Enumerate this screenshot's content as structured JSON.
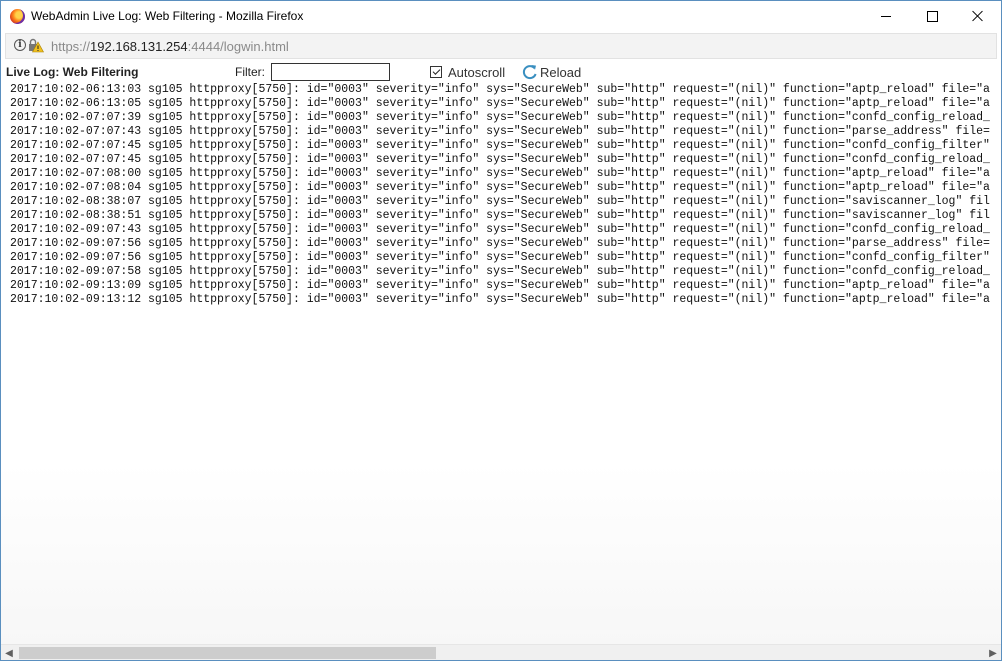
{
  "window": {
    "title": "WebAdmin Live Log: Web Filtering - Mozilla Firefox"
  },
  "urlbar": {
    "scheme": "https://",
    "host": "192.168.131.254",
    "rest": ":4444/logwin.html"
  },
  "app": {
    "title": "Live Log: Web Filtering",
    "filter_label": "Filter:",
    "filter_value": "",
    "autoscroll_label": "Autoscroll",
    "autoscroll_checked": true,
    "reload_label": "Reload"
  },
  "icons": {
    "browser": "firefox-icon",
    "info": "info-icon",
    "security": "mixed-content-lock-icon",
    "reload": "reload-icon"
  },
  "log": {
    "lines": [
      "2017:10:02-06:13:03 sg105 httpproxy[5750]: id=\"0003\" severity=\"info\" sys=\"SecureWeb\" sub=\"http\" request=\"(nil)\" function=\"aptp_reload\" file=\"a",
      "2017:10:02-06:13:05 sg105 httpproxy[5750]: id=\"0003\" severity=\"info\" sys=\"SecureWeb\" sub=\"http\" request=\"(nil)\" function=\"aptp_reload\" file=\"a",
      "2017:10:02-07:07:39 sg105 httpproxy[5750]: id=\"0003\" severity=\"info\" sys=\"SecureWeb\" sub=\"http\" request=\"(nil)\" function=\"confd_config_reload_",
      "2017:10:02-07:07:43 sg105 httpproxy[5750]: id=\"0003\" severity=\"info\" sys=\"SecureWeb\" sub=\"http\" request=\"(nil)\" function=\"parse_address\" file=",
      "2017:10:02-07:07:45 sg105 httpproxy[5750]: id=\"0003\" severity=\"info\" sys=\"SecureWeb\" sub=\"http\" request=\"(nil)\" function=\"confd_config_filter\"",
      "2017:10:02-07:07:45 sg105 httpproxy[5750]: id=\"0003\" severity=\"info\" sys=\"SecureWeb\" sub=\"http\" request=\"(nil)\" function=\"confd_config_reload_",
      "2017:10:02-07:08:00 sg105 httpproxy[5750]: id=\"0003\" severity=\"info\" sys=\"SecureWeb\" sub=\"http\" request=\"(nil)\" function=\"aptp_reload\" file=\"a",
      "2017:10:02-07:08:04 sg105 httpproxy[5750]: id=\"0003\" severity=\"info\" sys=\"SecureWeb\" sub=\"http\" request=\"(nil)\" function=\"aptp_reload\" file=\"a",
      "2017:10:02-08:38:07 sg105 httpproxy[5750]: id=\"0003\" severity=\"info\" sys=\"SecureWeb\" sub=\"http\" request=\"(nil)\" function=\"saviscanner_log\" fil",
      "2017:10:02-08:38:51 sg105 httpproxy[5750]: id=\"0003\" severity=\"info\" sys=\"SecureWeb\" sub=\"http\" request=\"(nil)\" function=\"saviscanner_log\" fil",
      "2017:10:02-09:07:43 sg105 httpproxy[5750]: id=\"0003\" severity=\"info\" sys=\"SecureWeb\" sub=\"http\" request=\"(nil)\" function=\"confd_config_reload_",
      "2017:10:02-09:07:56 sg105 httpproxy[5750]: id=\"0003\" severity=\"info\" sys=\"SecureWeb\" sub=\"http\" request=\"(nil)\" function=\"parse_address\" file=",
      "2017:10:02-09:07:56 sg105 httpproxy[5750]: id=\"0003\" severity=\"info\" sys=\"SecureWeb\" sub=\"http\" request=\"(nil)\" function=\"confd_config_filter\"",
      "2017:10:02-09:07:58 sg105 httpproxy[5750]: id=\"0003\" severity=\"info\" sys=\"SecureWeb\" sub=\"http\" request=\"(nil)\" function=\"confd_config_reload_",
      "2017:10:02-09:13:09 sg105 httpproxy[5750]: id=\"0003\" severity=\"info\" sys=\"SecureWeb\" sub=\"http\" request=\"(nil)\" function=\"aptp_reload\" file=\"a",
      "2017:10:02-09:13:12 sg105 httpproxy[5750]: id=\"0003\" severity=\"info\" sys=\"SecureWeb\" sub=\"http\" request=\"(nil)\" function=\"aptp_reload\" file=\"a"
    ]
  },
  "scrollbar": {
    "horizontal_position": 0.0,
    "visible_fraction": 0.42
  },
  "colors": {
    "window_border": "#5a8fbf",
    "reload_icon": "#3a8fc0",
    "warning": "#f0c020"
  }
}
